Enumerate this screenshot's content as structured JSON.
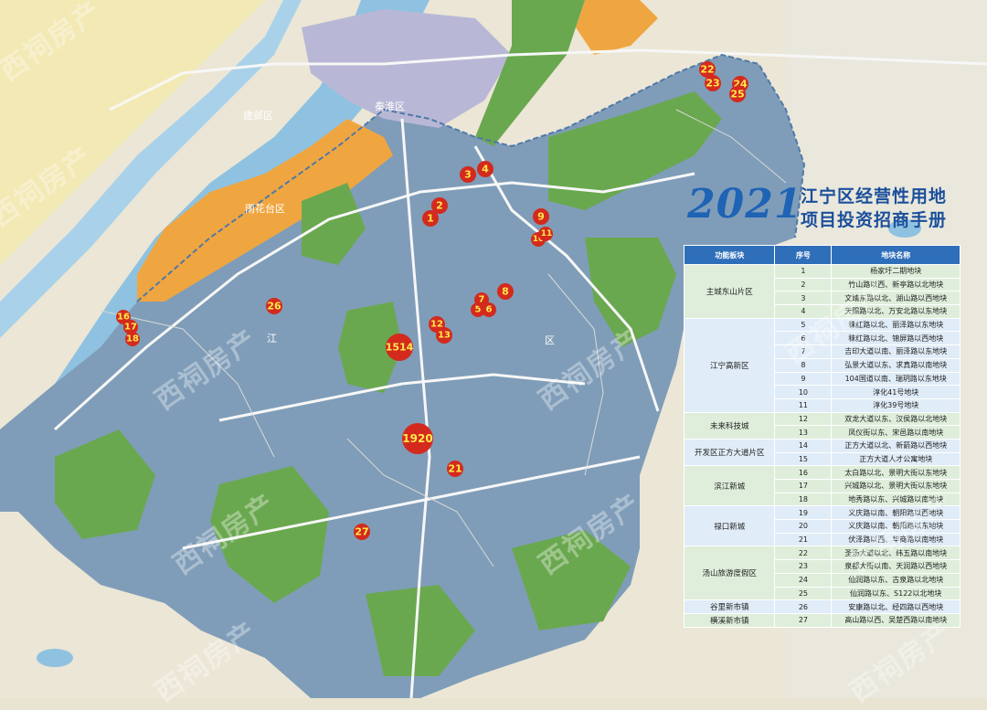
{
  "title": {
    "year": "2021",
    "line1": "江宁区经营性用地",
    "line2": "项目投资招商手册"
  },
  "table": {
    "headers": [
      "功能板块",
      "序号",
      "地块名称"
    ],
    "groups": [
      {
        "name": "主城东山片区",
        "rows": [
          [
            "1",
            "杨家圩二期地块"
          ],
          [
            "2",
            "竹山路以西、新亭路以北地块"
          ],
          [
            "3",
            "文靖东路以北、湖山路以西地块"
          ],
          [
            "4",
            "天赐路以北、万安北路以东地块"
          ]
        ]
      },
      {
        "name": "江宁高新区",
        "rows": [
          [
            "5",
            "秣红路以北、丽泽路以东地块"
          ],
          [
            "6",
            "秣红路以北、锦屏路以西地块"
          ],
          [
            "7",
            "吉印大道以南、丽泽路以东地块"
          ],
          [
            "8",
            "弘景大道以东、求真路以南地块"
          ],
          [
            "9",
            "104国道以南、瑞玥路以东地块"
          ],
          [
            "10",
            "淳化41号地块"
          ],
          [
            "11",
            "淳化39号地块"
          ]
        ]
      },
      {
        "name": "未来科技城",
        "rows": [
          [
            "12",
            "双龙大道以东、汉侯路以北地块"
          ],
          [
            "13",
            "凤仪街以东、宋邑路以南地块"
          ]
        ]
      },
      {
        "name": "开发区正方大道片区",
        "rows": [
          [
            "14",
            "正方大道以北、新箭路以西地块"
          ],
          [
            "15",
            "正方大道人才公寓地块"
          ]
        ]
      },
      {
        "name": "滨江新城",
        "rows": [
          [
            "16",
            "太白路以北、景明大街以东地块"
          ],
          [
            "17",
            "兴城路以北、景明大街以东地块"
          ],
          [
            "18",
            "地秀路以东、兴城路以南地块"
          ]
        ]
      },
      {
        "name": "禄口新城",
        "rows": [
          [
            "19",
            "义庆路以南、朝阳路以西地块"
          ],
          [
            "20",
            "义庆路以南、朝阳路以东地块"
          ],
          [
            "21",
            "伏泽路以西、华商路以南地块"
          ]
        ]
      },
      {
        "name": "汤山旅游度假区",
        "rows": [
          [
            "22",
            "圣汤大道以北、纬五路以南地块"
          ],
          [
            "23",
            "泉都大街以南、天润路以西地块"
          ],
          [
            "24",
            "仙润路以东、古泉路以北地块"
          ],
          [
            "25",
            "仙润路以东、S122以北地块"
          ]
        ]
      },
      {
        "name": "谷里新市镇",
        "rows": [
          [
            "26",
            "安康路以北、经四路以西地块"
          ]
        ]
      },
      {
        "name": "横溪新市镇",
        "rows": [
          [
            "27",
            "高山路以西、吴楚西路以南地块"
          ]
        ]
      }
    ]
  },
  "markers": [
    "1",
    "2",
    "3",
    "4",
    "5",
    "6",
    "7",
    "8",
    "9",
    "10",
    "11",
    "12",
    "13",
    "1514",
    "16",
    "17",
    "18",
    "1920",
    "21",
    "22",
    "23",
    "24",
    "25",
    "26",
    "27"
  ],
  "district_labels": [
    "江",
    "区",
    "建邺区",
    "秦淮区",
    "雨花台区"
  ],
  "watermark": "西祠房产",
  "colors": {
    "district": "#7f9db8",
    "green": "#6aa84f",
    "water": "#8fc2e0",
    "orange": "#f0a640",
    "marker": "#d42a1e",
    "marker_text": "#ffe94a",
    "header": "#2f6fba"
  }
}
